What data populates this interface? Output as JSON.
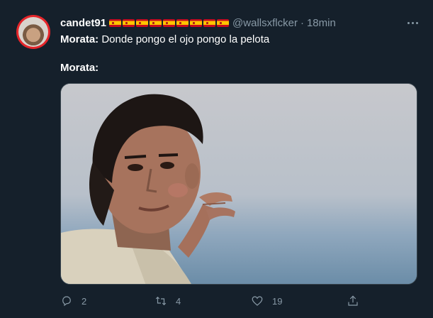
{
  "tweet": {
    "display_name": "candet91",
    "flag_count": 9,
    "handle": "@wallsxflcker",
    "separator": "·",
    "time": "18min",
    "line1_bold": "Morata:",
    "line1_text": " Donde pongo el ojo pongo la pelota",
    "line2_bold": "Morata:"
  },
  "actions": {
    "reply_count": "2",
    "retweet_count": "4",
    "like_count": "19"
  },
  "icons": {
    "reply": "reply-icon",
    "retweet": "retweet-icon",
    "like": "heart-icon",
    "share": "share-icon",
    "more": "more-icon"
  },
  "colors": {
    "background": "#15202b",
    "secondary_text": "#8899a6",
    "avatar_ring": "#e5252a"
  }
}
